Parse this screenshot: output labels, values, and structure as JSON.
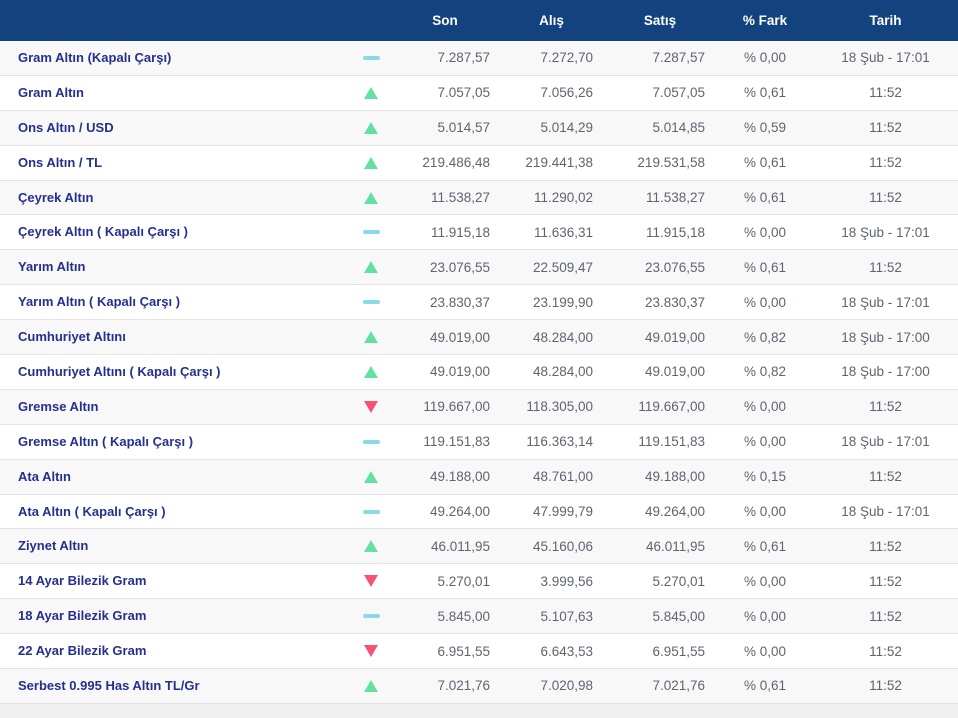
{
  "colors": {
    "header_bg": "#13437e",
    "label": "#23308d",
    "value": "#5e6470",
    "up": "#63e1a2",
    "down": "#f5536f",
    "flat": "#8bd8e7"
  },
  "table": {
    "columns": {
      "son": "Son",
      "alis": "Alış",
      "satis": "Satış",
      "fark": "% Fark",
      "tarih": "Tarih"
    },
    "rows": [
      {
        "name": "Gram Altın (Kapalı Çarşı)",
        "trend": "flat",
        "son": "7.287,57",
        "alis": "7.272,70",
        "satis": "7.287,57",
        "fark": "% 0,00",
        "tarih": "18 Şub - 17:01"
      },
      {
        "name": "Gram Altın",
        "trend": "up",
        "son": "7.057,05",
        "alis": "7.056,26",
        "satis": "7.057,05",
        "fark": "% 0,61",
        "tarih": "11:52"
      },
      {
        "name": "Ons Altın / USD",
        "trend": "up",
        "son": "5.014,57",
        "alis": "5.014,29",
        "satis": "5.014,85",
        "fark": "% 0,59",
        "tarih": "11:52"
      },
      {
        "name": "Ons Altın / TL",
        "trend": "up",
        "son": "219.486,48",
        "alis": "219.441,38",
        "satis": "219.531,58",
        "fark": "% 0,61",
        "tarih": "11:52"
      },
      {
        "name": "Çeyrek Altın",
        "trend": "up",
        "son": "11.538,27",
        "alis": "11.290,02",
        "satis": "11.538,27",
        "fark": "% 0,61",
        "tarih": "11:52"
      },
      {
        "name": "Çeyrek Altın ( Kapalı Çarşı )",
        "trend": "flat",
        "son": "11.915,18",
        "alis": "11.636,31",
        "satis": "11.915,18",
        "fark": "% 0,00",
        "tarih": "18 Şub - 17:01"
      },
      {
        "name": "Yarım Altın",
        "trend": "up",
        "son": "23.076,55",
        "alis": "22.509,47",
        "satis": "23.076,55",
        "fark": "% 0,61",
        "tarih": "11:52"
      },
      {
        "name": "Yarım Altın ( Kapalı Çarşı )",
        "trend": "flat",
        "son": "23.830,37",
        "alis": "23.199,90",
        "satis": "23.830,37",
        "fark": "% 0,00",
        "tarih": "18 Şub - 17:01"
      },
      {
        "name": "Cumhuriyet Altını",
        "trend": "up",
        "son": "49.019,00",
        "alis": "48.284,00",
        "satis": "49.019,00",
        "fark": "% 0,82",
        "tarih": "18 Şub - 17:00"
      },
      {
        "name": "Cumhuriyet Altını ( Kapalı Çarşı )",
        "trend": "up",
        "son": "49.019,00",
        "alis": "48.284,00",
        "satis": "49.019,00",
        "fark": "% 0,82",
        "tarih": "18 Şub - 17:00"
      },
      {
        "name": "Gremse Altın",
        "trend": "down",
        "son": "119.667,00",
        "alis": "118.305,00",
        "satis": "119.667,00",
        "fark": "% 0,00",
        "tarih": "11:52"
      },
      {
        "name": "Gremse Altın ( Kapalı Çarşı )",
        "trend": "flat",
        "son": "119.151,83",
        "alis": "116.363,14",
        "satis": "119.151,83",
        "fark": "% 0,00",
        "tarih": "18 Şub - 17:01"
      },
      {
        "name": "Ata Altın",
        "trend": "up",
        "son": "49.188,00",
        "alis": "48.761,00",
        "satis": "49.188,00",
        "fark": "% 0,15",
        "tarih": "11:52"
      },
      {
        "name": "Ata Altın ( Kapalı Çarşı )",
        "trend": "flat",
        "son": "49.264,00",
        "alis": "47.999,79",
        "satis": "49.264,00",
        "fark": "% 0,00",
        "tarih": "18 Şub - 17:01"
      },
      {
        "name": "Ziynet Altın",
        "trend": "up",
        "son": "46.011,95",
        "alis": "45.160,06",
        "satis": "46.011,95",
        "fark": "% 0,61",
        "tarih": "11:52"
      },
      {
        "name": "14 Ayar Bilezik Gram",
        "trend": "down",
        "son": "5.270,01",
        "alis": "3.999,56",
        "satis": "5.270,01",
        "fark": "% 0,00",
        "tarih": "11:52"
      },
      {
        "name": "18 Ayar Bilezik Gram",
        "trend": "flat",
        "son": "5.845,00",
        "alis": "5.107,63",
        "satis": "5.845,00",
        "fark": "% 0,00",
        "tarih": "11:52"
      },
      {
        "name": "22 Ayar Bilezik Gram",
        "trend": "down",
        "son": "6.951,55",
        "alis": "6.643,53",
        "satis": "6.951,55",
        "fark": "% 0,00",
        "tarih": "11:52"
      },
      {
        "name": "Serbest 0.995 Has Altın TL/Gr",
        "trend": "up",
        "son": "7.021,76",
        "alis": "7.020,98",
        "satis": "7.021,76",
        "fark": "% 0,61",
        "tarih": "11:52"
      }
    ]
  }
}
